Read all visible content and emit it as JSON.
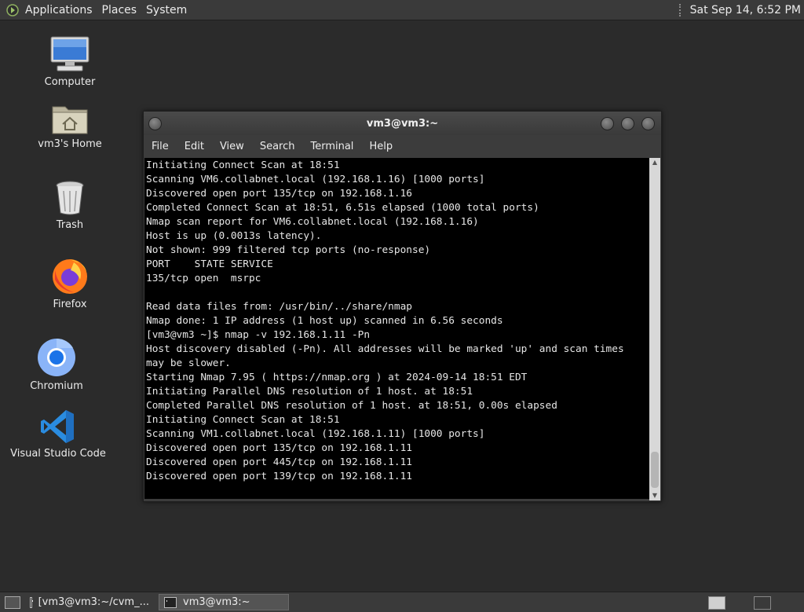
{
  "top_panel": {
    "menus": [
      "Applications",
      "Places",
      "System"
    ],
    "clock": "Sat Sep 14,  6:52 PM"
  },
  "desktop_icons": [
    {
      "label": "Computer",
      "icon": "computer-icon"
    },
    {
      "label": "vm3's Home",
      "icon": "home-folder-icon"
    },
    {
      "label": "Trash",
      "icon": "trash-icon"
    },
    {
      "label": "Firefox",
      "icon": "firefox-icon"
    },
    {
      "label": "Chromium",
      "icon": "chromium-icon"
    },
    {
      "label": "Visual Studio Code",
      "icon": "vscode-icon"
    }
  ],
  "terminal": {
    "title": "vm3@vm3:~",
    "menus": [
      "File",
      "Edit",
      "View",
      "Search",
      "Terminal",
      "Help"
    ],
    "lines": [
      "Initiating Connect Scan at 18:51",
      "Scanning VM6.collabnet.local (192.168.1.16) [1000 ports]",
      "Discovered open port 135/tcp on 192.168.1.16",
      "Completed Connect Scan at 18:51, 6.51s elapsed (1000 total ports)",
      "Nmap scan report for VM6.collabnet.local (192.168.1.16)",
      "Host is up (0.0013s latency).",
      "Not shown: 999 filtered tcp ports (no-response)",
      "PORT    STATE SERVICE",
      "135/tcp open  msrpc",
      "",
      "Read data files from: /usr/bin/../share/nmap",
      "Nmap done: 1 IP address (1 host up) scanned in 6.56 seconds",
      "[vm3@vm3 ~]$ nmap -v 192.168.1.11 -Pn",
      "Host discovery disabled (-Pn). All addresses will be marked 'up' and scan times",
      "may be slower.",
      "Starting Nmap 7.95 ( https://nmap.org ) at 2024-09-14 18:51 EDT",
      "Initiating Parallel DNS resolution of 1 host. at 18:51",
      "Completed Parallel DNS resolution of 1 host. at 18:51, 0.00s elapsed",
      "Initiating Connect Scan at 18:51",
      "Scanning VM1.collabnet.local (192.168.1.11) [1000 ports]",
      "Discovered open port 135/tcp on 192.168.1.11",
      "Discovered open port 445/tcp on 192.168.1.11",
      "Discovered open port 139/tcp on 192.168.1.11"
    ]
  },
  "taskbar": {
    "tasks": [
      {
        "label": "[vm3@vm3:~/cvm_...",
        "active": false
      },
      {
        "label": "vm3@vm3:~",
        "active": true
      }
    ]
  }
}
